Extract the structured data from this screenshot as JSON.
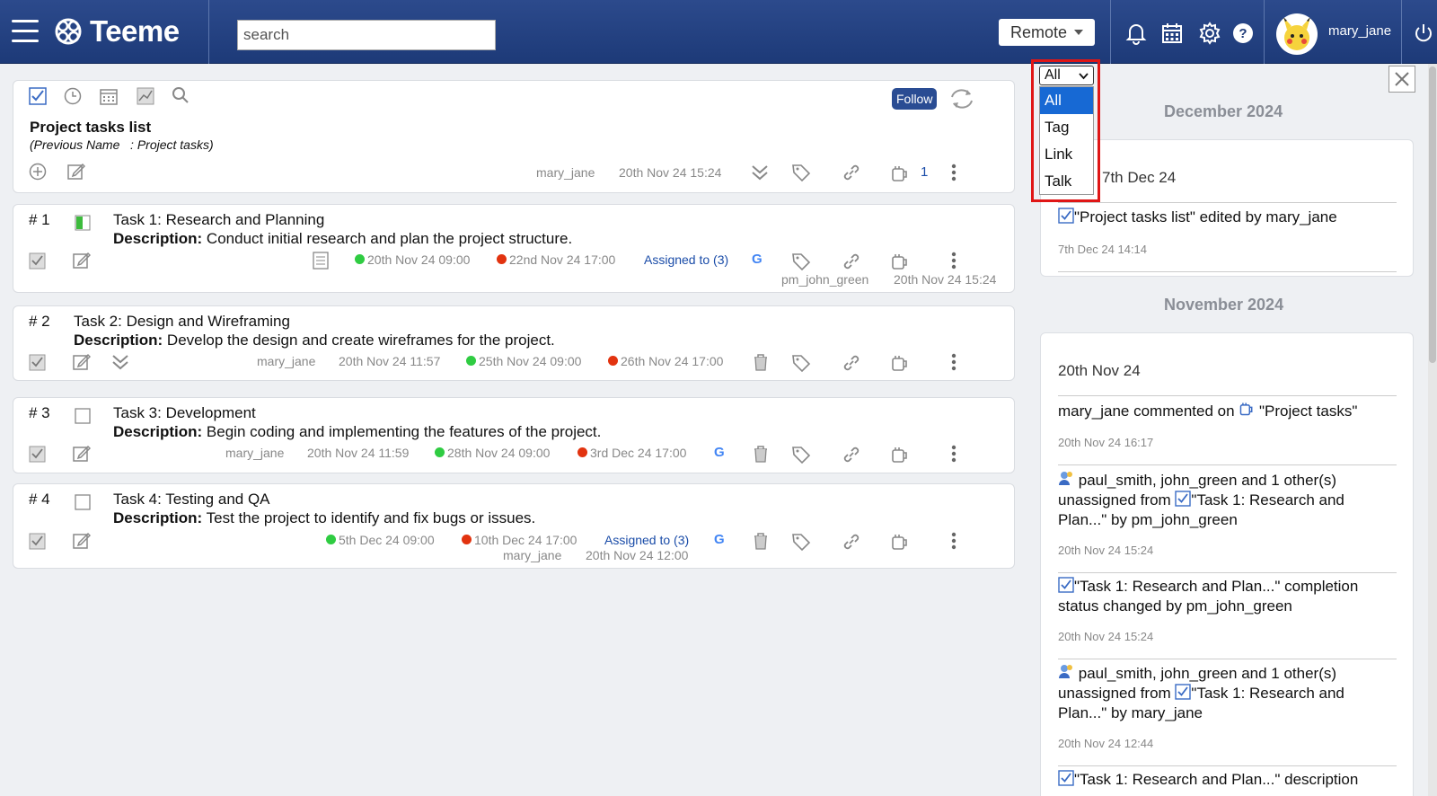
{
  "app": {
    "brand": "Teeme"
  },
  "topbar": {
    "search_placeholder": "search",
    "mode_label": "Remote",
    "username": "mary_jane"
  },
  "list": {
    "title": "Project tasks list",
    "subtitle": "(Previous Name   : Project tasks)",
    "follow_label": "Follow",
    "author": "mary_jane",
    "timestamp": "20th Nov 24 15:24",
    "talk_count": "1"
  },
  "tasks": [
    {
      "number": "# 1",
      "title": "Task 1: Research and Planning",
      "desc_label": "Description:",
      "description": "Conduct initial research and plan the project structure.",
      "start": "20th Nov 24 09:00",
      "end": "22nd Nov 24 17:00",
      "assigned": "Assigned to (3)",
      "google": "G",
      "editor": "pm_john_green",
      "edited": "20th Nov 24 15:24"
    },
    {
      "number": "# 2",
      "title": "Task 2: Design and Wireframing",
      "desc_label": "Description:",
      "description": "Develop the design and create wireframes for the project.",
      "author": "mary_jane",
      "created": "20th Nov 24 11:57",
      "start": "25th Nov 24 09:00",
      "end": "26th Nov 24 17:00"
    },
    {
      "number": "# 3",
      "title": "Task 3: Development",
      "desc_label": "Description:",
      "description": "Begin coding and implementing the features of the project.",
      "author": "mary_jane",
      "created": "20th Nov 24 11:59",
      "start": "28th Nov 24 09:00",
      "end": "3rd Dec 24 17:00",
      "google": "G"
    },
    {
      "number": "# 4",
      "title": "Task 4: Testing and QA",
      "desc_label": "Description:",
      "description": "Test the project to identify and fix bugs or issues.",
      "start": "5th Dec 24 09:00",
      "end": "10th Dec 24 17:00",
      "assigned": "Assigned to (3)",
      "google": "G",
      "author": "mary_jane",
      "created": "20th Nov 24 12:00"
    }
  ],
  "filter": {
    "selected": "All",
    "options": [
      "All",
      "Tag",
      "Link",
      "Talk"
    ]
  },
  "feed": {
    "months": [
      "December 2024",
      "November 2024"
    ],
    "dec_day": "7th Dec 24",
    "dec_items": [
      {
        "text": "\"Project tasks list\" edited by mary_jane",
        "time": "7th Dec 24 14:14"
      }
    ],
    "nov_day": "20th Nov 24",
    "nov_items": [
      {
        "text1": "mary_jane commented on",
        "text2": "\"Project tasks\"",
        "time": "20th Nov 24 16:17"
      },
      {
        "line1": "paul_smith, john_green and 1 other(s)",
        "line2a": "unassigned from",
        "line2b": "\"Task 1: Research and",
        "line3": "Plan...\" by pm_john_green",
        "time": "20th Nov 24 15:24"
      },
      {
        "line1": "\"Task 1: Research and Plan...\" completion",
        "line2": "status changed by pm_john_green",
        "time": "20th Nov 24 15:24"
      },
      {
        "line1": "paul_smith, john_green and 1 other(s)",
        "line2a": "unassigned from",
        "line2b": "\"Task 1: Research and",
        "line3": "Plan...\" by mary_jane",
        "time": "20th Nov 24 12:44"
      },
      {
        "line1": "\"Task 1: Research and Plan...\" description"
      }
    ]
  },
  "colors": {
    "topbar": "#1d3a78",
    "accent": "#2a4c93",
    "start_dot": "#2fcc42",
    "end_dot": "#e2330f",
    "highlight": "#e01616"
  }
}
